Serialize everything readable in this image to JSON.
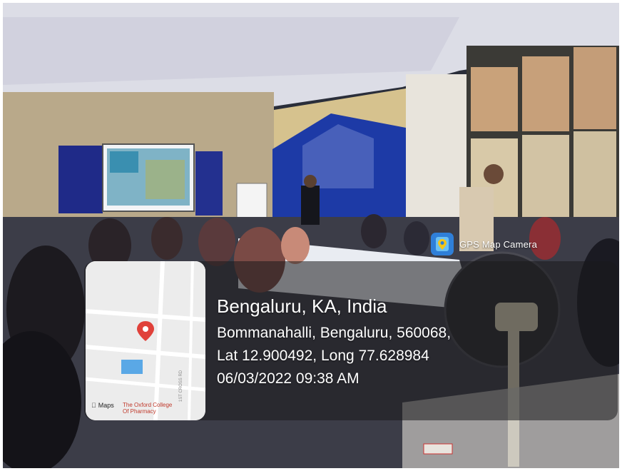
{
  "badge": {
    "label": "GPS Map Camera",
    "icon": "map-pin-icon"
  },
  "location": {
    "city": "Bengaluru, KA, India",
    "address": "Bommanahalli, Bengaluru, 560068,",
    "coords": "Lat 12.900492, Long 77.628984",
    "datetime": "06/03/2022 09:38 AM"
  },
  "map": {
    "brand": "Maps",
    "place": "The Oxford College Of Pharmacy",
    "road": "1ST CROSS RD",
    "pin_color": "#e0413a",
    "building_color": "#5aa8e6"
  }
}
